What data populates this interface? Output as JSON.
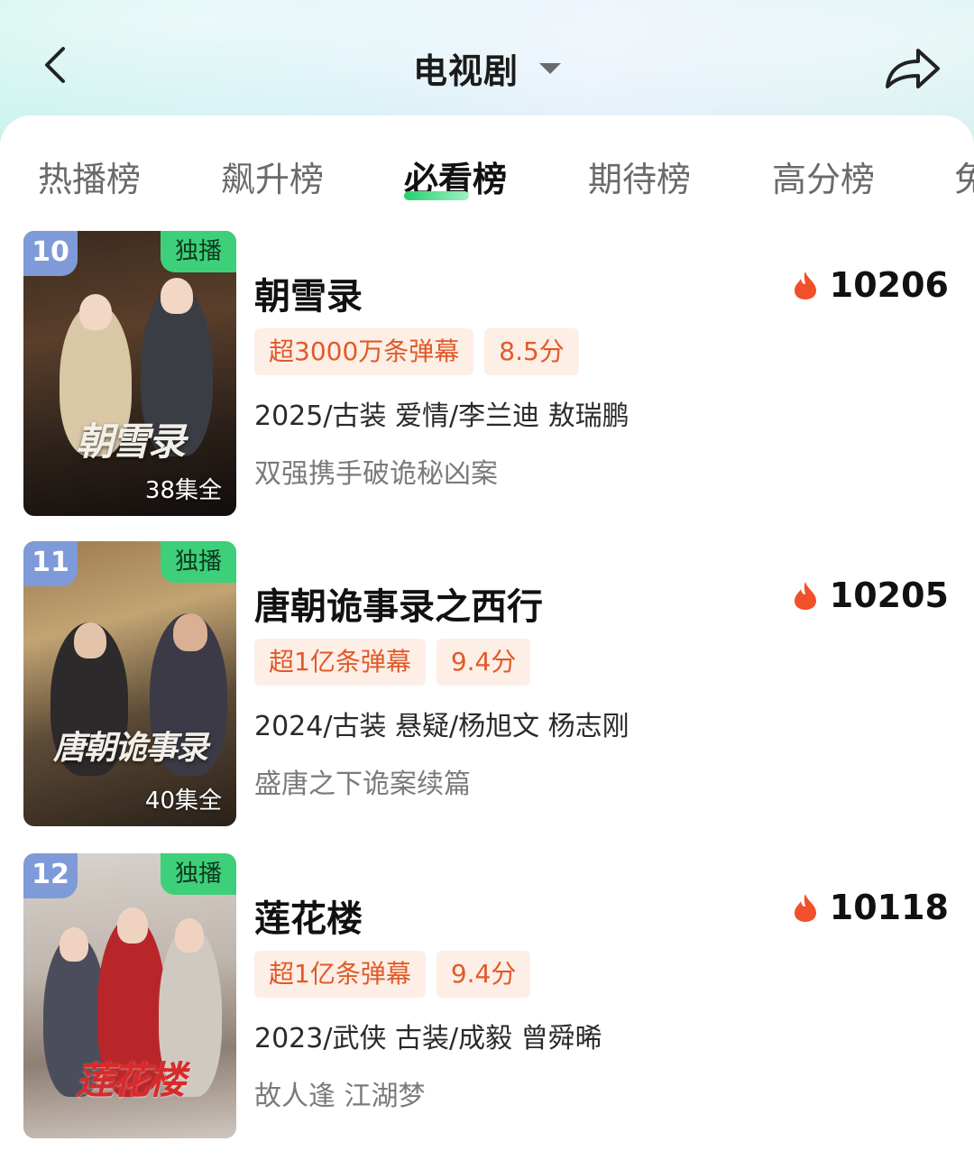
{
  "header": {
    "title": "电视剧",
    "back_icon": "chevron-left-icon",
    "dropdown_icon": "caret-down-icon",
    "share_icon": "share-arrow-icon"
  },
  "tabs": [
    {
      "label": "热播榜",
      "active": false
    },
    {
      "label": "飙升榜",
      "active": false
    },
    {
      "label": "必看榜",
      "active": true
    },
    {
      "label": "期待榜",
      "active": false
    },
    {
      "label": "高分榜",
      "active": false
    },
    {
      "label": "免",
      "active": false
    }
  ],
  "colors": {
    "accent_green": "#26d06b",
    "rank_badge": "#7f9ad8",
    "exclusive_badge": "#3ecf7a",
    "tag_bg": "#fdeee6",
    "tag_text": "#e05a2a",
    "heat_icon": "#f0502a"
  },
  "list": [
    {
      "rank": "10",
      "exclusive": "独播",
      "episodes": "38集全",
      "poster_text": "朝雪录",
      "title": "朝雪录",
      "heat": "10206",
      "tags": [
        "超3000万条弹幕",
        "8.5分"
      ],
      "meta": "2025/古装 爱情/李兰迪 敖瑞鹏",
      "desc": "双强携手破诡秘凶案"
    },
    {
      "rank": "11",
      "exclusive": "独播",
      "episodes": "40集全",
      "poster_text": "唐朝诡事录",
      "title": "唐朝诡事录之西行",
      "heat": "10205",
      "tags": [
        "超1亿条弹幕",
        "9.4分"
      ],
      "meta": "2024/古装 悬疑/杨旭文 杨志刚",
      "desc": "盛唐之下诡案续篇"
    },
    {
      "rank": "12",
      "exclusive": "独播",
      "episodes": "",
      "poster_text": "莲花楼",
      "title": "莲花楼",
      "heat": "10118",
      "tags": [
        "超1亿条弹幕",
        "9.4分"
      ],
      "meta": "2023/武侠 古装/成毅 曾舜晞",
      "desc": "故人逢 江湖梦"
    }
  ]
}
